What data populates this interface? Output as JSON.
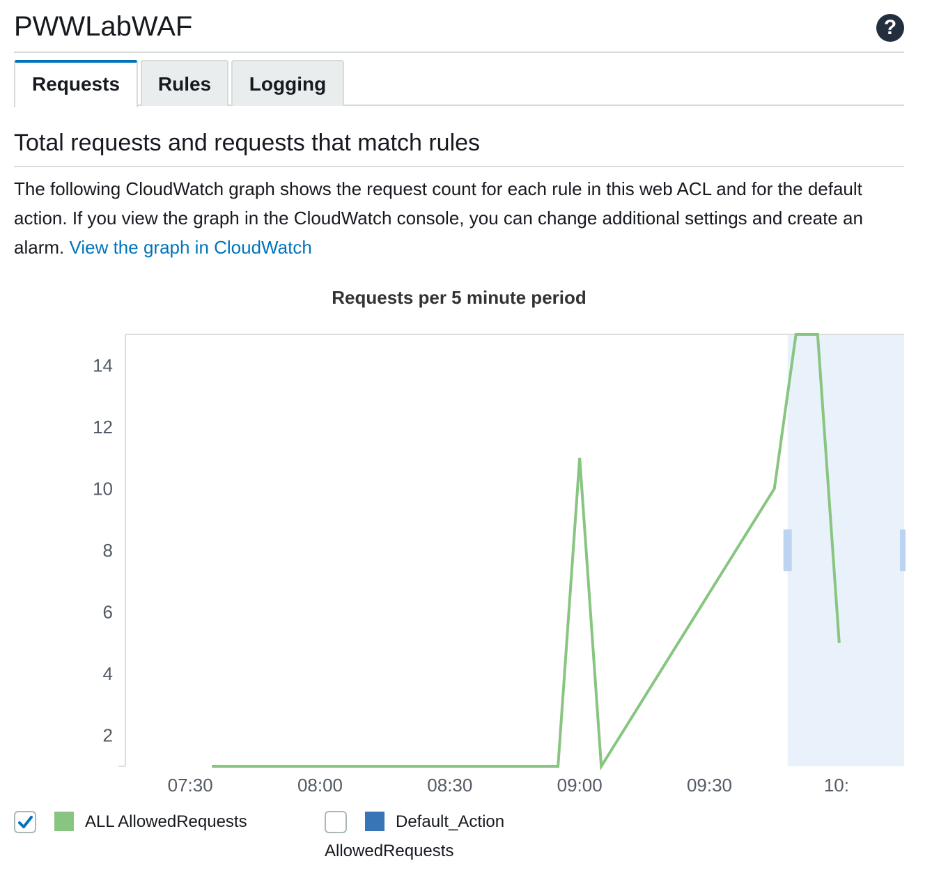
{
  "page": {
    "title": "PWWLabWAF",
    "help_icon": "question-circle-icon"
  },
  "tabs": [
    {
      "label": "Requests",
      "active": true
    },
    {
      "label": "Rules",
      "active": false
    },
    {
      "label": "Logging",
      "active": false
    }
  ],
  "section": {
    "title": "Total requests and requests that match rules",
    "description": "The following CloudWatch graph shows the request count for each rule in this web ACL and for the default action. If you view the graph in the CloudWatch console, you can change additional settings and create an alarm. ",
    "link_text": "View the graph in CloudWatch"
  },
  "chart_data": {
    "type": "line",
    "title": "Requests per 5 minute period",
    "xlabel": "",
    "ylabel": "",
    "x_ticks": [
      "07:30",
      "08:00",
      "08:30",
      "09:00",
      "09:30",
      "10:"
    ],
    "y_ticks": [
      2,
      4,
      6,
      8,
      10,
      12,
      14
    ],
    "ylim": [
      1,
      15
    ],
    "grid": false,
    "colors": {
      "accent": "#88c580",
      "series2": "#3875b6",
      "highlight": "#e9f1fb",
      "highlight_marker": "#bcd4f2"
    },
    "series": [
      {
        "name": "ALL AllowedRequests",
        "color": "#88c580",
        "x": [
          "07:35",
          "07:40",
          "07:45",
          "07:50",
          "07:55",
          "08:00",
          "08:05",
          "08:10",
          "08:15",
          "08:20",
          "08:25",
          "08:30",
          "08:35",
          "08:40",
          "08:45",
          "08:50",
          "08:55",
          "09:00",
          "09:05",
          "09:45",
          "09:50",
          "09:55",
          "10:00"
        ],
        "values": [
          1,
          1,
          1,
          1,
          1,
          1,
          1,
          1,
          1,
          1,
          1,
          1,
          1,
          1,
          1,
          1,
          1,
          11,
          1,
          10,
          15,
          15,
          5
        ]
      }
    ]
  },
  "legend": [
    {
      "label": "ALL AllowedRequests",
      "checked": true,
      "color": "#88c580"
    },
    {
      "label": "Default_Action",
      "label2": "AllowedRequests",
      "checked": false,
      "color": "#3875b6"
    }
  ]
}
